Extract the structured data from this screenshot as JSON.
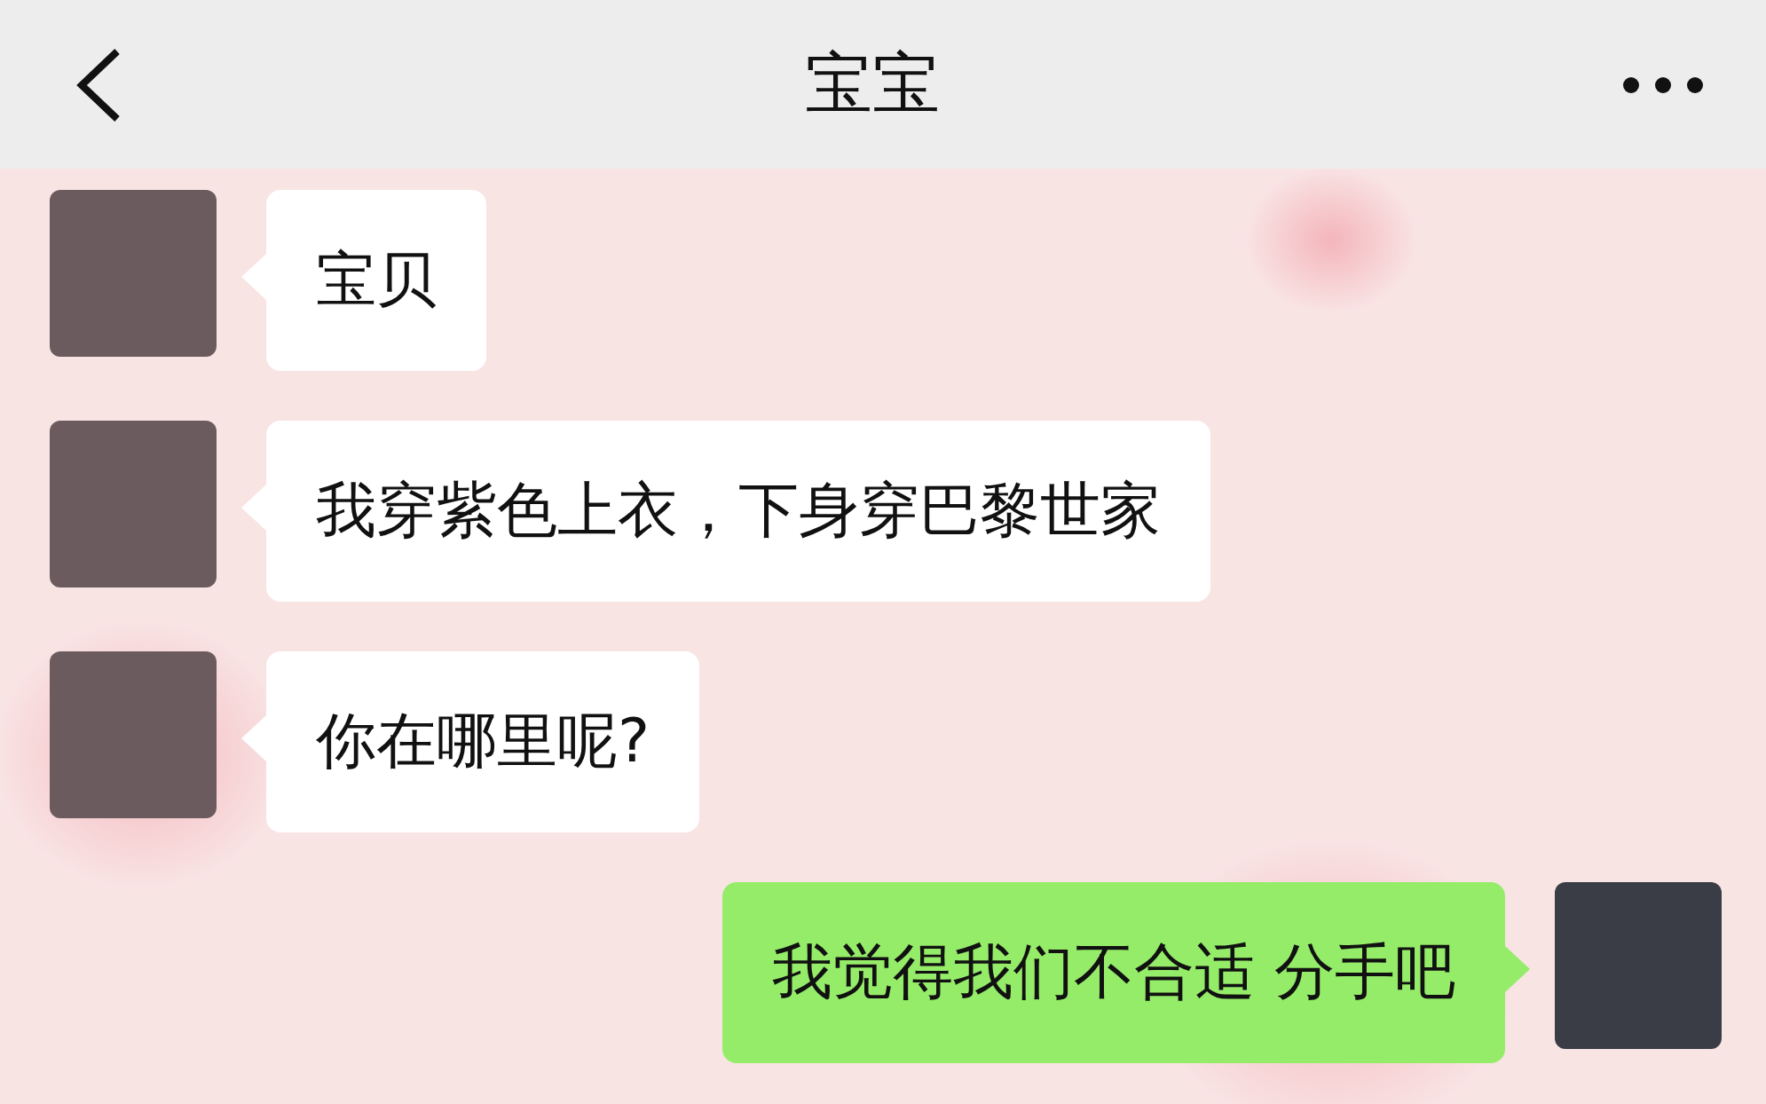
{
  "header": {
    "title": "宝宝"
  },
  "messages": [
    {
      "kind": "incoming",
      "text": "宝贝"
    },
    {
      "kind": "incoming",
      "text": "我穿紫色上衣，下身穿巴黎世家"
    },
    {
      "kind": "incoming",
      "text": "你在哪里呢?"
    },
    {
      "kind": "outgoing",
      "text": "我觉得我们不合适 分手吧"
    }
  ]
}
